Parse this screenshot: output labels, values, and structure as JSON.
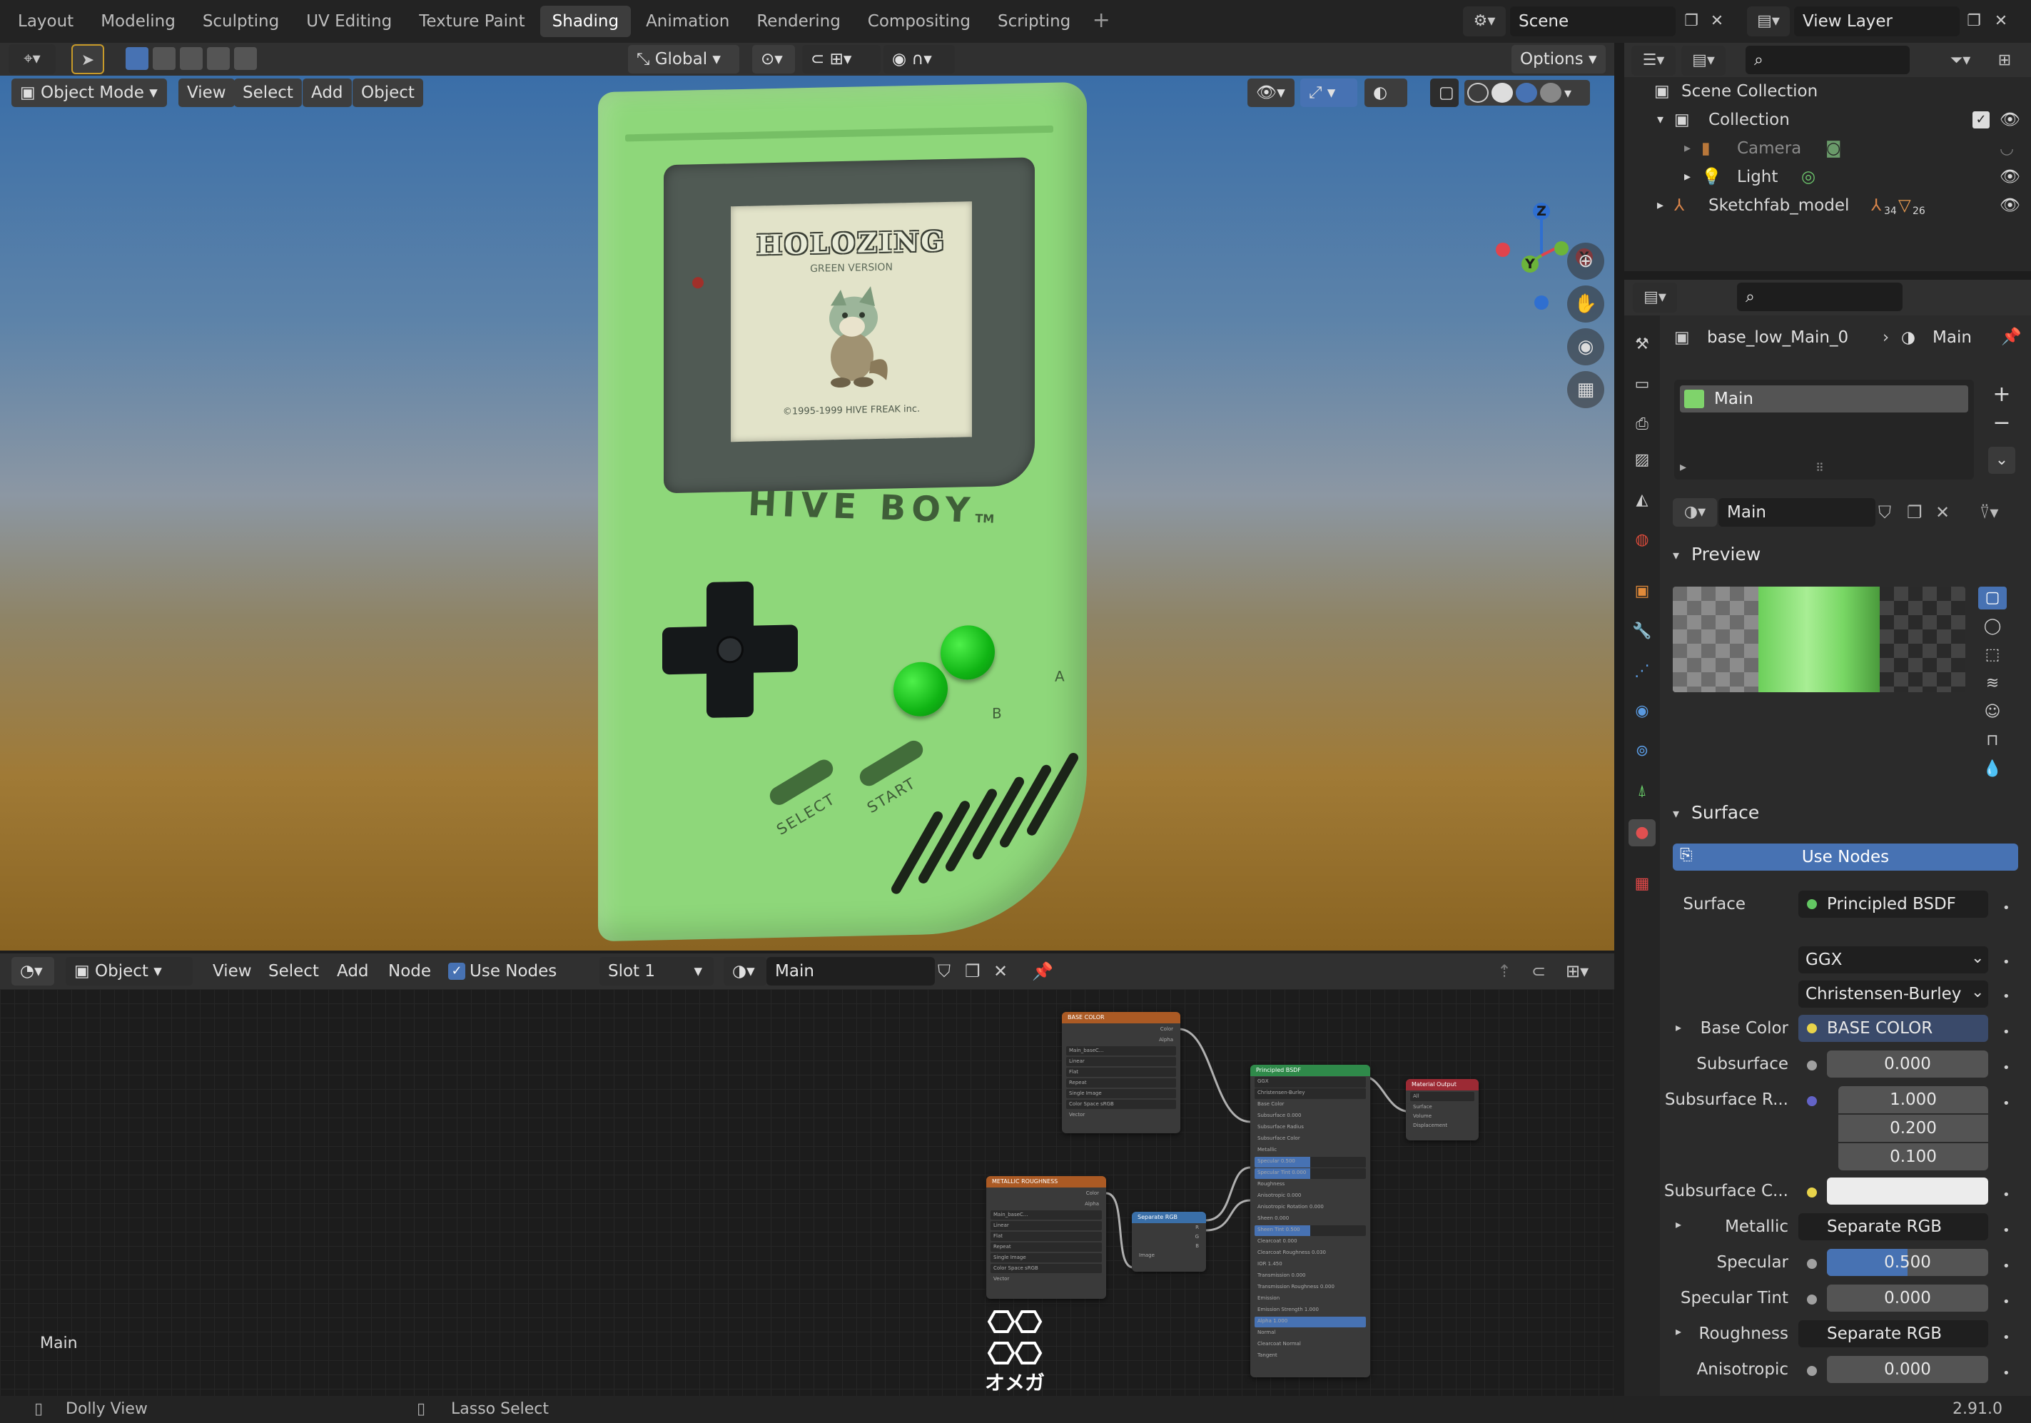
{
  "workspace_tabs": [
    "Layout",
    "Modeling",
    "Sculpting",
    "UV Editing",
    "Texture Paint",
    "Shading",
    "Animation",
    "Rendering",
    "Compositing",
    "Scripting"
  ],
  "active_tab": "Shading",
  "scene_field": "Scene",
  "view_layer_field": "View Layer",
  "viewport_header": {
    "transform_orientation": "Global",
    "options_label": "Options",
    "mode": "Object Mode",
    "menus": [
      "View",
      "Select",
      "Add",
      "Object"
    ]
  },
  "model_screen": {
    "title": "HOLOZING",
    "subtitle": "GREEN VERSION",
    "copyright": "©1995-1999 HIVE FREAK inc.",
    "brand": "HIVE BOY",
    "brand_tm": "TM",
    "select_label": "SELECT",
    "start_label": "START",
    "a_label": "A",
    "b_label": "B"
  },
  "node_header": {
    "editor_type": "Object",
    "menus": [
      "View",
      "Select",
      "Add",
      "Node"
    ],
    "use_nodes_label": "Use Nodes",
    "slot": "Slot 1",
    "material": "Main"
  },
  "node_editor": {
    "label": "Main",
    "watermark": "オメガ",
    "nodes": {
      "base_color": {
        "title": "BASE COLOR",
        "outputs": [
          "Color",
          "Alpha"
        ],
        "rows": [
          "Main_baseC...",
          "Linear",
          "Flat",
          "Repeat",
          "Single Image",
          "Color Space   sRGB",
          "Vector"
        ]
      },
      "metallic": {
        "title": "METALLIC ROUGHNESS",
        "outputs": [
          "Color",
          "Alpha"
        ],
        "rows": [
          "Main_baseC...",
          "Linear",
          "Flat",
          "Repeat",
          "Single Image",
          "Color Space   sRGB",
          "Vector"
        ]
      },
      "separate": {
        "title": "Separate RGB",
        "outputs": [
          "R",
          "G",
          "B"
        ],
        "rows": [
          "Image"
        ]
      },
      "bsdf": {
        "title": "Principled BSDF",
        "rows": [
          "GGX",
          "Christensen-Burley",
          "Base Color",
          "Subsurface      0.000",
          "Subsurface Radius",
          "Subsurface Color",
          "Metallic",
          "Specular       0.500",
          "Specular Tint  0.000",
          "Roughness",
          "Anisotropic    0.000",
          "Anisotropic Rotation 0.000",
          "Sheen          0.000",
          "Sheen Tint     0.500",
          "Clearcoat      0.000",
          "Clearcoat Roughness 0.030",
          "IOR            1.450",
          "Transmission   0.000",
          "Transmission Roughness 0.000",
          "Emission",
          "Emission Strength 1.000",
          "Alpha          1.000",
          "Normal",
          "Clearcoat Normal",
          "Tangent"
        ]
      },
      "output": {
        "title": "Material Output",
        "rows": [
          "All",
          "Surface",
          "Volume",
          "Displacement"
        ]
      }
    }
  },
  "status_bar": {
    "left": "Dolly View",
    "middle": "Lasso Select",
    "version": "2.91.0"
  },
  "outliner": {
    "items": [
      {
        "label": "Scene Collection"
      },
      {
        "label": "Collection"
      },
      {
        "label": "Camera"
      },
      {
        "label": "Light"
      },
      {
        "label": "Sketchfab_model",
        "badge1": "34",
        "badge2": "26"
      }
    ]
  },
  "properties": {
    "object_name": "base_low_Main_0",
    "material_name": "Main",
    "slot_item": "Main",
    "material_field": "Main",
    "preview_label": "Preview",
    "surface_section": "Surface",
    "use_nodes_button": "Use Nodes",
    "rows": {
      "surface": {
        "label": "Surface",
        "value": "Principled BSDF"
      },
      "distribution": "GGX",
      "subsurface_method": "Christensen-Burley",
      "base_color": {
        "label": "Base Color",
        "value": "BASE COLOR"
      },
      "subsurface": {
        "label": "Subsurface",
        "value": "0.000"
      },
      "subsurface_radius": {
        "label": "Subsurface R...",
        "values": [
          "1.000",
          "0.200",
          "0.100"
        ]
      },
      "subsurface_color": {
        "label": "Subsurface C..."
      },
      "metallic": {
        "label": "Metallic",
        "value": "Separate RGB"
      },
      "specular": {
        "label": "Specular",
        "value": "0.500",
        "fraction": 0.5
      },
      "specular_tint": {
        "label": "Specular Tint",
        "value": "0.000"
      },
      "roughness": {
        "label": "Roughness",
        "value": "Separate RGB"
      },
      "anisotropic": {
        "label": "Anisotropic",
        "value": "0.000"
      }
    }
  },
  "colors": {
    "accent": "#4772b3",
    "model": "#8ed77a",
    "button": "#10b414"
  }
}
